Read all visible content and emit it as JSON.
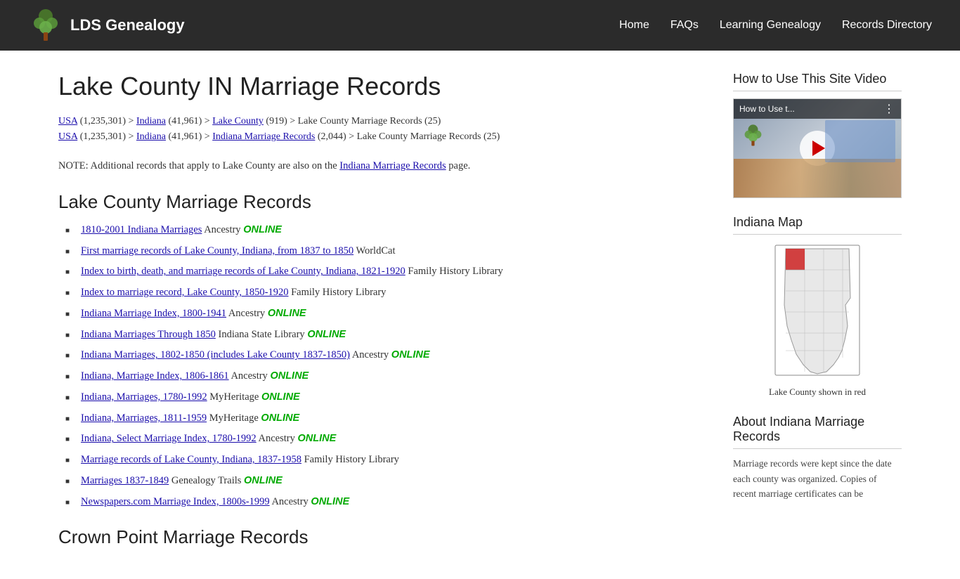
{
  "header": {
    "logo_text": "LDS Genealogy",
    "nav": {
      "home": "Home",
      "faqs": "FAQs",
      "learning_genealogy": "Learning Genealogy",
      "records_directory": "Records Directory"
    }
  },
  "main": {
    "page_title": "Lake County IN Marriage Records",
    "breadcrumbs": [
      {
        "line": 1,
        "parts": [
          {
            "text": "USA",
            "link": true
          },
          {
            "text": " (1,235,301) > ",
            "link": false
          },
          {
            "text": "Indiana",
            "link": true
          },
          {
            "text": " (41,961) > ",
            "link": false
          },
          {
            "text": "Lake County",
            "link": true
          },
          {
            "text": " (919) > Lake County Marriage Records (25)",
            "link": false
          }
        ]
      },
      {
        "line": 2,
        "parts": [
          {
            "text": "USA",
            "link": true
          },
          {
            "text": " (1,235,301) > ",
            "link": false
          },
          {
            "text": "Indiana",
            "link": true
          },
          {
            "text": " (41,961) > ",
            "link": false
          },
          {
            "text": "Indiana Marriage Records",
            "link": true
          },
          {
            "text": " (2,044) > Lake County Marriage Records (25)",
            "link": false
          }
        ]
      }
    ],
    "note": {
      "prefix": "NOTE: Additional records that apply to Lake County are also on the ",
      "link_text": "Indiana Marriage Records",
      "suffix": " page."
    },
    "sections": [
      {
        "id": "lake-county",
        "heading": "Lake County Marriage Records",
        "records": [
          {
            "link": "1810-2001 Indiana Marriages",
            "source": "Ancestry",
            "online": true
          },
          {
            "link": "First marriage records of Lake County, Indiana, from 1837 to 1850",
            "source": "WorldCat",
            "online": false
          },
          {
            "link": "Index to birth, death, and marriage records of Lake County, Indiana, 1821-1920",
            "source": "Family History Library",
            "online": false
          },
          {
            "link": "Index to marriage record, Lake County, 1850-1920",
            "source": "Family History Library",
            "online": false
          },
          {
            "link": "Indiana Marriage Index, 1800-1941",
            "source": "Ancestry",
            "online": true
          },
          {
            "link": "Indiana Marriages Through 1850",
            "source": "Indiana State Library",
            "online": true
          },
          {
            "link": "Indiana Marriages, 1802-1850 (includes Lake County 1837-1850)",
            "source": "Ancestry",
            "online": true
          },
          {
            "link": "Indiana, Marriage Index, 1806-1861",
            "source": "Ancestry",
            "online": true
          },
          {
            "link": "Indiana, Marriages, 1780-1992",
            "source": "MyHeritage",
            "online": true
          },
          {
            "link": "Indiana, Marriages, 1811-1959",
            "source": "MyHeritage",
            "online": true
          },
          {
            "link": "Indiana, Select Marriage Index, 1780-1992",
            "source": "Ancestry",
            "online": true
          },
          {
            "link": "Marriage records of Lake County, Indiana, 1837-1958",
            "source": "Family History Library",
            "online": false
          },
          {
            "link": "Marriages 1837-1849",
            "source": "Genealogy Trails",
            "online": true
          },
          {
            "link": "Newspapers.com Marriage Index, 1800s-1999",
            "source": "Ancestry",
            "online": true
          }
        ]
      },
      {
        "id": "crown-point",
        "heading": "Crown Point Marriage Records",
        "records": []
      }
    ]
  },
  "sidebar": {
    "video_section": {
      "heading": "How to Use This Site Video",
      "video_label": "How to Use t..."
    },
    "map_section": {
      "heading": "Indiana Map",
      "caption": "Lake County shown in red"
    },
    "about_section": {
      "heading": "About Indiana Marriage Records",
      "text": "Marriage records were kept since the date each county was organized. Copies of recent marriage certificates can be"
    }
  },
  "online_label": "ONLINE"
}
